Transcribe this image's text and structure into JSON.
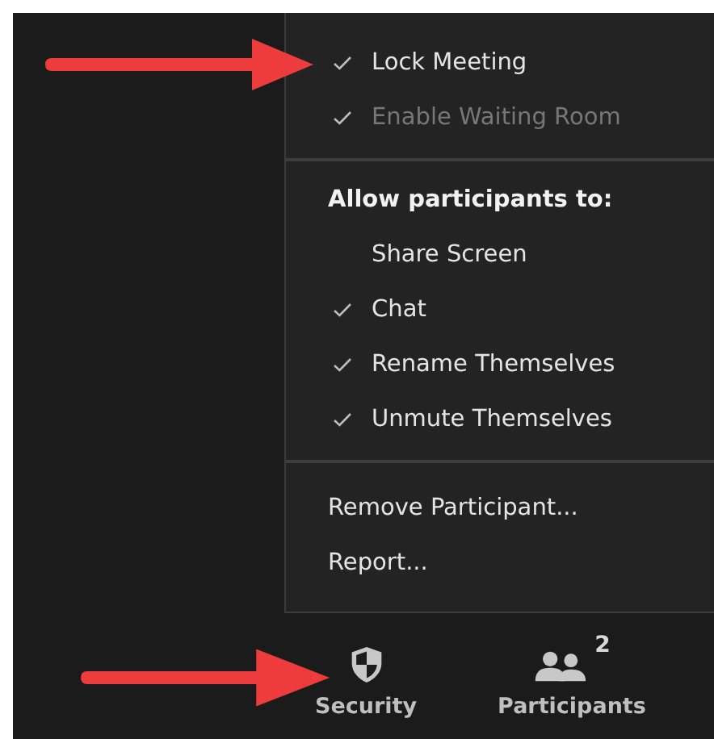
{
  "menu": {
    "sections": [
      {
        "kind": "checklist",
        "items": [
          {
            "label": "Lock Meeting",
            "checked": true,
            "disabled": false
          },
          {
            "label": "Enable Waiting Room",
            "checked": true,
            "disabled": true
          }
        ]
      },
      {
        "kind": "checklist",
        "heading": "Allow participants to:",
        "items": [
          {
            "label": "Share Screen",
            "checked": false,
            "disabled": false
          },
          {
            "label": "Chat",
            "checked": true,
            "disabled": false
          },
          {
            "label": "Rename Themselves",
            "checked": true,
            "disabled": false
          },
          {
            "label": "Unmute Themselves",
            "checked": true,
            "disabled": false
          }
        ]
      },
      {
        "kind": "actions",
        "items": [
          {
            "label": "Remove Participant..."
          },
          {
            "label": "Report..."
          }
        ]
      }
    ]
  },
  "toolbar": [
    {
      "kind": "shield",
      "label": "Security"
    },
    {
      "kind": "people",
      "label": "Participants",
      "badge": "2"
    }
  ]
}
